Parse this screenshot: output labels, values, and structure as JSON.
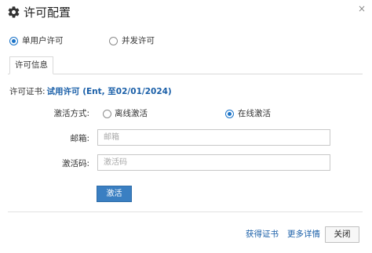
{
  "dialog": {
    "title": "许可配置",
    "title_icon": "gear-icon",
    "close_glyph": "×"
  },
  "license_mode": {
    "options": [
      {
        "label": "单用户许可",
        "selected": true
      },
      {
        "label": "并发许可",
        "selected": false
      }
    ]
  },
  "tabs": [
    {
      "label": "许可信息",
      "active": true
    }
  ],
  "license": {
    "label": "许可证书:",
    "value": "试用许可 (Ent, 至02/01/2024)"
  },
  "activation": {
    "method_label": "激活方式:",
    "methods": [
      {
        "label": "离线激活",
        "selected": false
      },
      {
        "label": "在线激活",
        "selected": true
      }
    ],
    "email_label": "邮箱:",
    "email_placeholder": "邮箱",
    "email_value": "",
    "code_label": "激活码:",
    "code_placeholder": "激活码",
    "code_value": "",
    "activate_button": "激活"
  },
  "footer": {
    "get_license_link": "获得证书",
    "more_details_link": "更多详情",
    "close_button": "关闭"
  },
  "colors": {
    "accent": "#1a73c8",
    "link": "#1a5fa8",
    "primary_button": "#3a7fc2"
  }
}
